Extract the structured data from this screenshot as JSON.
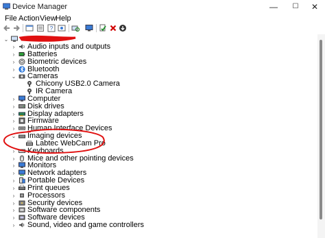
{
  "window": {
    "title": "Device Manager",
    "minimize_glyph": "—",
    "maximize_glyph": "☐",
    "close_glyph": "✕"
  },
  "menu": {
    "items": [
      "File",
      "Action",
      "View",
      "Help"
    ]
  },
  "toolbar": {
    "icons": [
      "back-arrow-icon",
      "forward-arrow-icon",
      "properties-icon",
      "show-hidden-icon",
      "help-icon",
      "scan-changes-icon",
      "monitor-icon",
      "update-driver-icon",
      "uninstall-x-icon",
      "download-icon"
    ],
    "uninstall_color": "#d10000"
  },
  "tree": {
    "root_expander": "⌄",
    "collapsed_glyph": "›",
    "expanded_glyph": "⌄",
    "items": [
      {
        "label": "Audio inputs and outputs",
        "icon": "speaker-icon"
      },
      {
        "label": "Batteries",
        "icon": "battery-icon"
      },
      {
        "label": "Biometric devices",
        "icon": "fingerprint-icon"
      },
      {
        "label": "Bluetooth",
        "icon": "bluetooth-icon"
      },
      {
        "label": "Cameras",
        "icon": "camera-icon",
        "expanded": true
      },
      {
        "label": "Chicony USB2.0 Camera",
        "icon": "webcam-icon",
        "child": true
      },
      {
        "label": "IR Camera",
        "icon": "webcam-icon",
        "child": true
      },
      {
        "label": "Computer",
        "icon": "computer-icon"
      },
      {
        "label": "Disk drives",
        "icon": "disk-drive-icon"
      },
      {
        "label": "Display adapters",
        "icon": "display-adapter-icon"
      },
      {
        "label": "Firmware",
        "icon": "firmware-icon"
      },
      {
        "label": "Human Interface Devices",
        "icon": "hid-icon"
      },
      {
        "label": "Imaging devices",
        "icon": "scanner-icon",
        "expanded": true
      },
      {
        "label": "Labtec WebCam Pro",
        "icon": "imaging-device-icon",
        "child": true
      },
      {
        "label": "Keyboards",
        "icon": "keyboard-icon"
      },
      {
        "label": "Mice and other pointing devices",
        "icon": "mouse-icon"
      },
      {
        "label": "Monitors",
        "icon": "monitor-icon"
      },
      {
        "label": "Network adapters",
        "icon": "network-adapter-icon"
      },
      {
        "label": "Portable Devices",
        "icon": "portable-device-icon"
      },
      {
        "label": "Print queues",
        "icon": "printer-icon"
      },
      {
        "label": "Processors",
        "icon": "processor-icon"
      },
      {
        "label": "Security devices",
        "icon": "security-icon"
      },
      {
        "label": "Software components",
        "icon": "software-component-icon"
      },
      {
        "label": "Software devices",
        "icon": "software-device-icon"
      },
      {
        "label": "Sound, video and game controllers",
        "icon": "sound-icon"
      }
    ]
  },
  "annotations": {
    "redaction_color": "#e01010",
    "circle_color": "#e01010"
  }
}
